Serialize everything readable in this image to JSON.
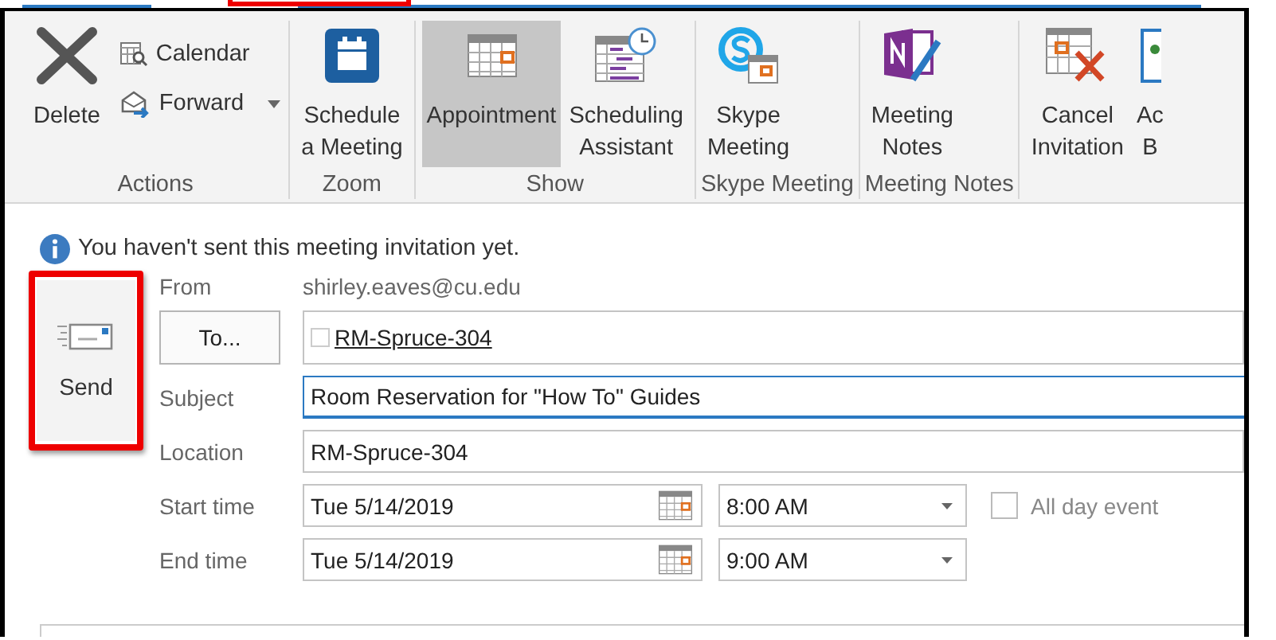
{
  "tab_strip": {
    "highlighted": true
  },
  "ribbon": {
    "groups": [
      {
        "label": "Actions",
        "buttons": [
          {
            "kind": "large",
            "label": "Delete"
          },
          {
            "kind": "small",
            "label": "Calendar"
          },
          {
            "kind": "small",
            "label": "Forward",
            "dropdown": true
          }
        ]
      },
      {
        "label": "Zoom",
        "buttons": [
          {
            "kind": "large",
            "label": "Schedule\na Meeting"
          }
        ]
      },
      {
        "label": "Show",
        "buttons": [
          {
            "kind": "large",
            "label": "Appointment",
            "selected": true
          },
          {
            "kind": "large",
            "label": "Scheduling\nAssistant",
            "selected": false
          }
        ]
      },
      {
        "label": "Skype Meeting",
        "buttons": [
          {
            "kind": "large",
            "label": "Skype\nMeeting"
          }
        ]
      },
      {
        "label": "Meeting Notes",
        "buttons": [
          {
            "kind": "large",
            "label": "Meeting\nNotes"
          }
        ]
      },
      {
        "buttons": [
          {
            "kind": "large",
            "label": "Cancel\nInvitation"
          },
          {
            "kind": "large",
            "label": "Ac\nB"
          }
        ]
      }
    ]
  },
  "info": "You haven't sent this meeting invitation yet.",
  "send_button": {
    "label": "Send",
    "highlighted": true
  },
  "from": {
    "label": "From",
    "value": "shirley.eaves@cu.edu"
  },
  "to": {
    "button": "To...",
    "recipients": [
      {
        "name": "RM-Spruce-304",
        "checked": false
      }
    ]
  },
  "subject": {
    "label": "Subject",
    "value": "Room Reservation for \"How To\" Guides",
    "focused": true
  },
  "location": {
    "label": "Location",
    "value": "RM-Spruce-304"
  },
  "start": {
    "label": "Start time",
    "date": "Tue 5/14/2019",
    "time": "8:00 AM"
  },
  "end": {
    "label": "End time",
    "date": "Tue 5/14/2019",
    "time": "9:00 AM"
  },
  "all_day": {
    "label": "All day event",
    "checked": false
  }
}
